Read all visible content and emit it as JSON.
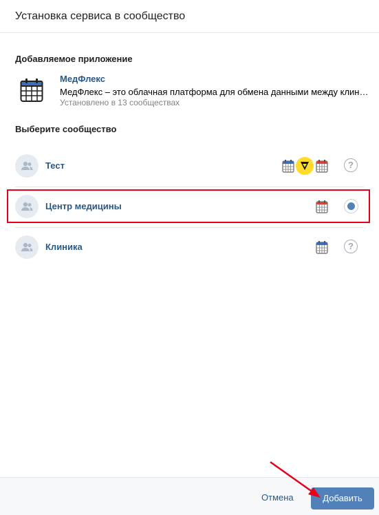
{
  "modal": {
    "title": "Установка сервиса в сообщество"
  },
  "app_section": {
    "label": "Добавляемое приложение",
    "app": {
      "name": "МедФлекс",
      "description": "МедФлекс – это облачная платформа для обмена данными между клиниками",
      "installed": "Установлено в 13 сообществах",
      "icon": "calendar-icon"
    }
  },
  "community_section": {
    "label": "Выберите сообщество",
    "communities": [
      {
        "name": "Тест",
        "services": [
          "calendar-blue-icon",
          "yandex-icon",
          "calendar-red-icon"
        ],
        "status": "?"
      },
      {
        "name": "Центр медицины",
        "services": [
          "calendar-red-icon"
        ],
        "status": "selected"
      },
      {
        "name": "Клиника",
        "services": [
          "calendar-blue-icon"
        ],
        "status": "?"
      }
    ]
  },
  "footer": {
    "cancel_label": "Отмена",
    "add_label": "Добавить"
  },
  "colors": {
    "accent": "#5181b8",
    "link": "#2a5885",
    "highlight": "#e6001a"
  }
}
